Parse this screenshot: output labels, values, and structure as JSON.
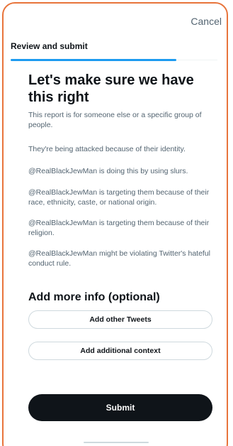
{
  "header": {
    "cancel_label": "Cancel",
    "section_label": "Review and submit"
  },
  "progress": {
    "fraction": 0.8
  },
  "main": {
    "title": "Let's make sure we have this right",
    "statements": [
      "This report is for someone else or a specific group of people.",
      "They're being attacked because of their identity.",
      "@RealBlackJewMan is doing this by using slurs.",
      "@RealBlackJewMan is targeting them because of their race, ethnicity, caste, or national origin.",
      "@RealBlackJewMan is targeting them because of their religion.",
      "@RealBlackJewMan might be violating Twitter's hateful conduct rule."
    ]
  },
  "more_info": {
    "title": "Add more info (optional)",
    "add_tweets_label": "Add other Tweets",
    "add_context_label": "Add additional context"
  },
  "footer": {
    "submit_label": "Submit"
  },
  "colors": {
    "frame": "#e8743b",
    "accent": "#1d9bf0",
    "primary_button": "#0f1419",
    "secondary_text": "#536471"
  }
}
